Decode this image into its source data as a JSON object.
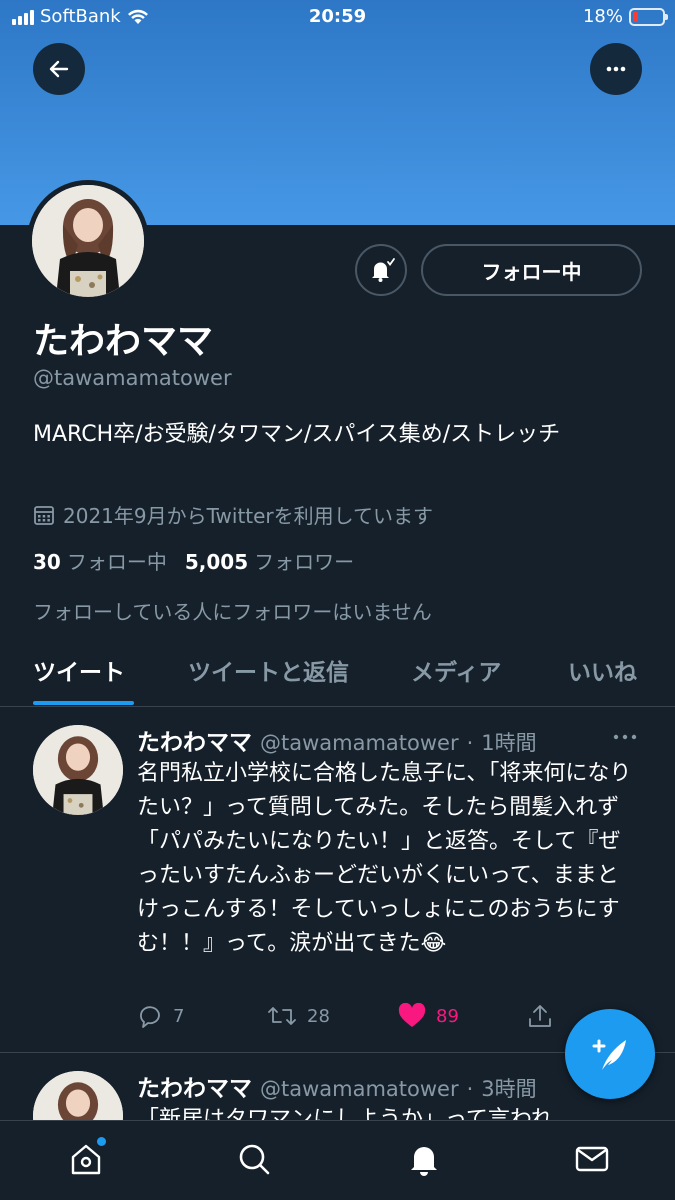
{
  "status_bar": {
    "carrier": "SoftBank",
    "time": "20:59",
    "battery": "18%",
    "battery_level": 0.18
  },
  "header": {
    "back_icon": "arrow-left-icon",
    "more_icon": "ellipsis-icon"
  },
  "profile": {
    "display_name": "たわわママ",
    "handle": "@tawamamatower",
    "bio": "MARCH卒/お受験/タワマン/スパイス集め/ストレッチ",
    "joined": "2021年9月からTwitterを利用しています",
    "following_count": "30",
    "following_label": "フォロー中",
    "followers_count": "5,005",
    "followers_label": "フォロワー",
    "followers_you_know": "フォローしている人にフォロワーはいません",
    "follow_button": "フォロー中",
    "notify_icon": "bell-check-icon"
  },
  "tabs": [
    {
      "label": "ツイート",
      "active": true
    },
    {
      "label": "ツイートと返信",
      "active": false
    },
    {
      "label": "メディア",
      "active": false
    },
    {
      "label": "いいね",
      "active": false
    }
  ],
  "tweets": [
    {
      "name": "たわわママ",
      "handle": "@tawamamatower",
      "time": "1時間",
      "text": "名門私立小学校に合格した息子に、「将来何になりたい？」って質問してみた。そしたら間髪入れず「パパみたいになりたい！」と返答。そして『ぜったいすたんふぉーどだいがくにいって、ままとけっこんする！そしていっしょにこのおうちにすむ！！』って。涙が出てきた😂",
      "replies": "7",
      "retweets": "28",
      "likes": "89",
      "liked": true
    },
    {
      "name": "たわわママ",
      "handle": "@tawamamatower",
      "time": "3時間",
      "text": "「新居はタワマンにしようか」って言われ"
    }
  ],
  "bottom_nav": [
    "home-icon",
    "search-icon",
    "notifications-icon",
    "messages-icon"
  ],
  "colors": {
    "background": "#15202b",
    "accent": "#1d9bf0",
    "muted": "#8899a6",
    "like": "#f91880"
  }
}
